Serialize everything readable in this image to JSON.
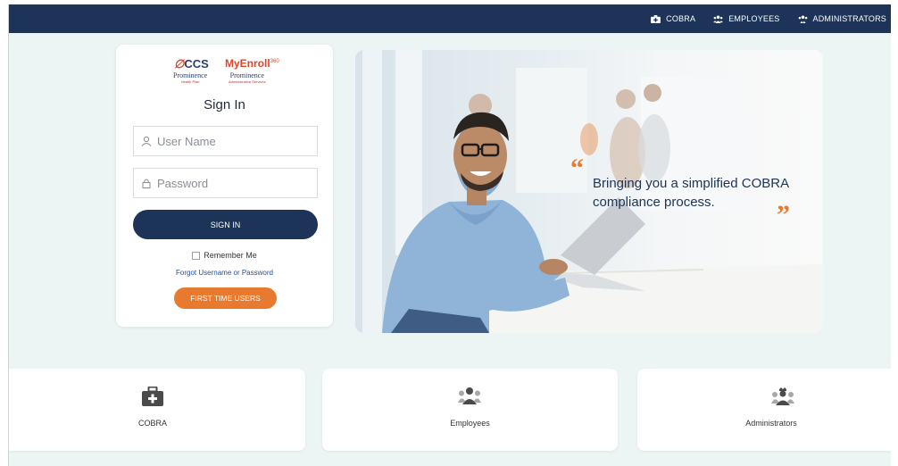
{
  "topnav": {
    "items": [
      {
        "label": "COBRA",
        "icon": "medical-kit-icon"
      },
      {
        "label": "EMPLOYEES",
        "icon": "group-icon"
      },
      {
        "label": "ADMINISTRATORS",
        "icon": "admin-group-icon"
      }
    ]
  },
  "logos": {
    "ccs": "CCS",
    "myenroll": "MyEnroll",
    "myenroll_sup": "360",
    "prominence_left": "Prominence",
    "prominence_left_sub": "Health Plan",
    "prominence_right": "Prominence",
    "prominence_right_sub": "Administrative Services"
  },
  "signin": {
    "title": "Sign In",
    "username_placeholder": "User Name",
    "password_placeholder": "Password",
    "button_label": "SIGN IN",
    "remember_label": "Remember Me",
    "forgot_label": "Forgot Username or Password",
    "first_time_label": "FIRST TIME USERS"
  },
  "hero": {
    "tagline": "Bringing you a simplified COBRA compliance process."
  },
  "cards": [
    {
      "label": "COBRA",
      "icon": "medical-kit-icon"
    },
    {
      "label": "Employees",
      "icon": "group-icon"
    },
    {
      "label": "Administrators",
      "icon": "admin-group-icon"
    }
  ],
  "colors": {
    "navy": "#1d3358",
    "orange": "#e87a30",
    "background": "#edf4f4"
  }
}
